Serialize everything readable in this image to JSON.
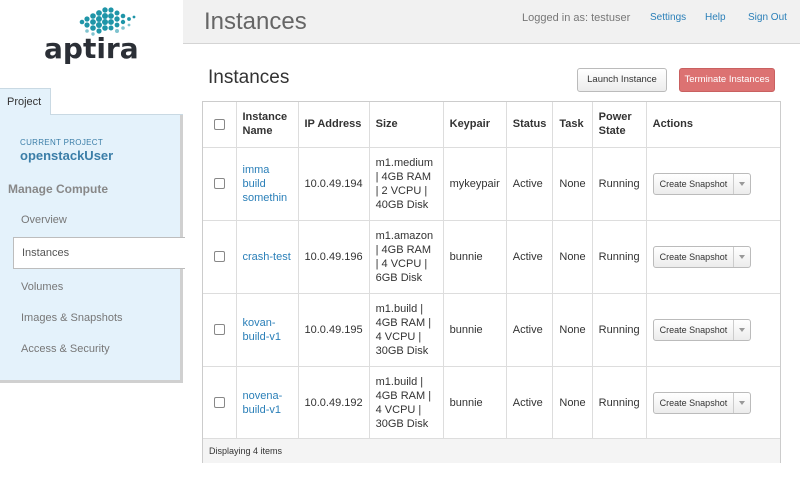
{
  "brand": {
    "logo_text": "aptira"
  },
  "sidebar": {
    "tab": "Project",
    "current_project_label": "CURRENT PROJECT",
    "current_project_name": "openstackUser",
    "section_title": "Manage Compute",
    "items": [
      {
        "label": "Overview"
      },
      {
        "label": "Instances",
        "active": true
      },
      {
        "label": "Volumes"
      },
      {
        "label": "Images & Snapshots"
      },
      {
        "label": "Access & Security"
      }
    ]
  },
  "header": {
    "title": "Instances",
    "logged_in": "Logged in as: testuser",
    "links": [
      "Settings",
      "Help",
      "Sign Out"
    ]
  },
  "main": {
    "title": "Instances",
    "launch_button": "Launch Instance",
    "terminate_button": "Terminate Instances",
    "table": {
      "headers": [
        "Instance Name",
        "IP Address",
        "Size",
        "Keypair",
        "Status",
        "Task",
        "Power State",
        "Actions"
      ],
      "rows": [
        {
          "name": "imma build somethin",
          "ip": "10.0.49.194",
          "size": "m1.medium | 4GB RAM | 2 VCPU | 40GB Disk",
          "keypair": "mykeypair",
          "status": "Active",
          "task": "None",
          "power": "Running",
          "action": "Create Snapshot"
        },
        {
          "name": "crash-test",
          "ip": "10.0.49.196",
          "size": "m1.amazon | 4GB RAM | 4 VCPU | 6GB Disk",
          "keypair": "bunnie",
          "status": "Active",
          "task": "None",
          "power": "Running",
          "action": "Create Snapshot"
        },
        {
          "name": "kovan-build-v1",
          "ip": "10.0.49.195",
          "size": "m1.build | 4GB RAM | 4 VCPU | 30GB Disk",
          "keypair": "bunnie",
          "status": "Active",
          "task": "None",
          "power": "Running",
          "action": "Create Snapshot"
        },
        {
          "name": "novena-build-v1",
          "ip": "10.0.49.192",
          "size": "m1.build | 4GB RAM | 4 VCPU | 30GB Disk",
          "keypair": "bunnie",
          "status": "Active",
          "task": "None",
          "power": "Running",
          "action": "Create Snapshot"
        }
      ],
      "footer": "Displaying 4 items"
    }
  },
  "colors": {
    "accent_blue": "#2a7fb8",
    "sidebar_bg": "#e4f2fb",
    "danger": "#dc7272"
  }
}
